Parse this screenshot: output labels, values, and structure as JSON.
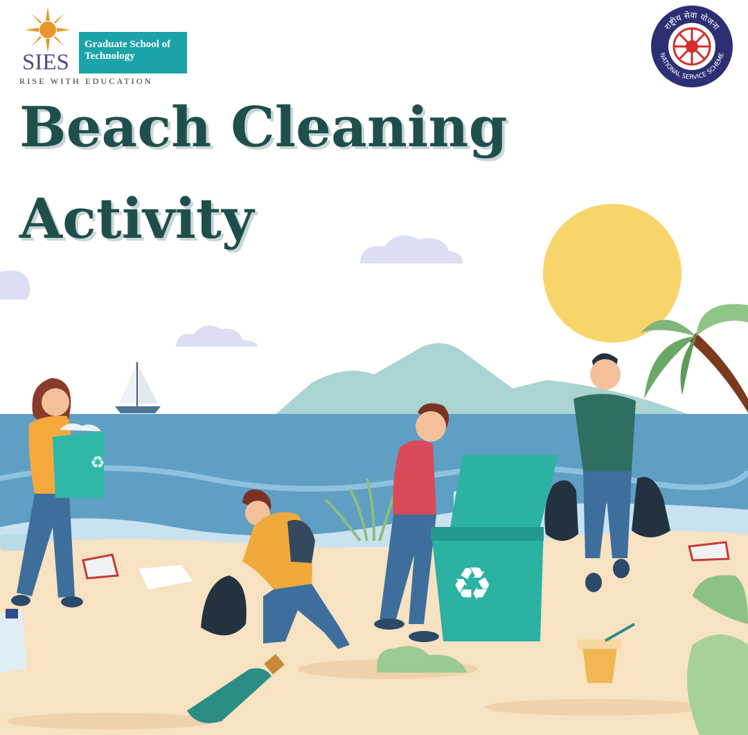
{
  "branding": {
    "sies": "SIES",
    "gst_line1": "Graduate School of",
    "gst_line2": "Technology",
    "tagline": "RISE WITH EDUCATION",
    "nss_top": "राष्ट्रीय सेवा योजना",
    "nss_bottom": "NATIONAL SERVICE SCHEME"
  },
  "poster": {
    "title_line1": "Beach Cleaning",
    "title_line2": "Activity"
  },
  "colors": {
    "title": "#1f4f4c",
    "sea": "#5f9fc4",
    "sand": "#f7e2c2",
    "sun": "#f7d56b",
    "bin": "#2bb2a3",
    "brand_teal": "#1aa3a8"
  }
}
